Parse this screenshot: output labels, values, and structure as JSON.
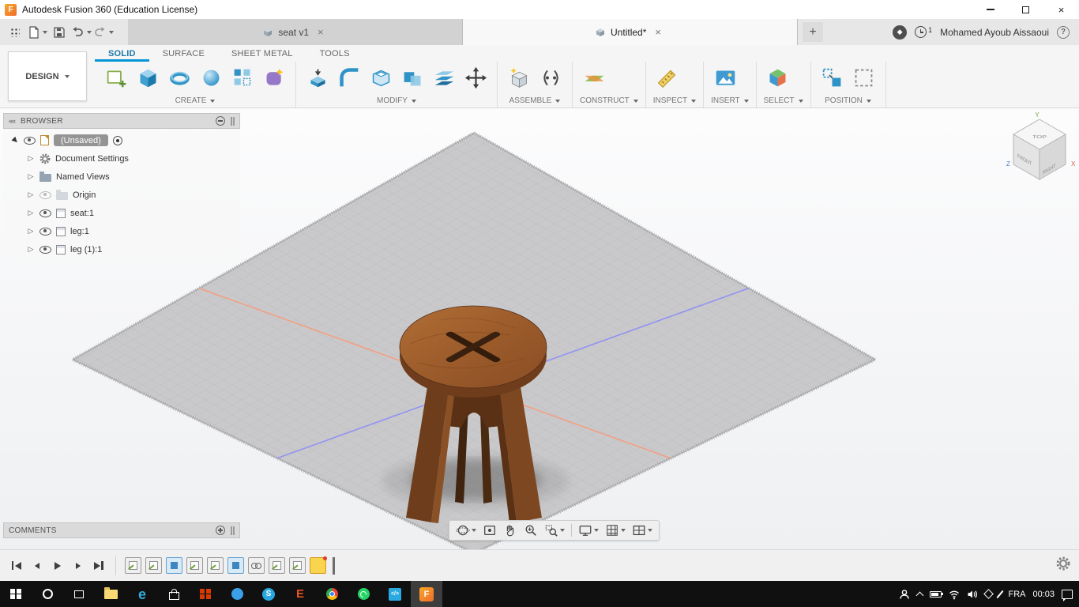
{
  "glyphs": {
    "close": "×",
    "add": "+",
    "help": "?",
    "diamond": "◆",
    "expander": "▷",
    "expander_open": "▶",
    "fusion_letter": "F",
    "collapse": "««"
  },
  "window": {
    "title": "Autodesk Fusion 360 (Education License)"
  },
  "tabs": {
    "documents": [
      {
        "label": "seat v1"
      },
      {
        "label": "Untitled*"
      }
    ]
  },
  "account": {
    "user_name": "Mohamed Ayoub Aissaoui",
    "notification_count": "1"
  },
  "ribbon": {
    "workspace_label": "DESIGN",
    "tabs": [
      "SOLID",
      "SURFACE",
      "SHEET METAL",
      "TOOLS"
    ],
    "active_tab": "SOLID",
    "groups": [
      {
        "label": "CREATE"
      },
      {
        "label": "MODIFY"
      },
      {
        "label": "ASSEMBLE"
      },
      {
        "label": "CONSTRUCT"
      },
      {
        "label": "INSPECT"
      },
      {
        "label": "INSERT"
      },
      {
        "label": "SELECT"
      },
      {
        "label": "POSITION"
      }
    ]
  },
  "browser": {
    "header": "BROWSER",
    "items": [
      {
        "label": "(Unsaved)"
      },
      {
        "label": "Document Settings"
      },
      {
        "label": "Named Views"
      },
      {
        "label": "Origin"
      },
      {
        "label": "seat:1"
      },
      {
        "label": "leg:1"
      },
      {
        "label": "leg (1):1"
      }
    ]
  },
  "comments": {
    "header": "COMMENTS"
  },
  "viewcube": {
    "top": "TOP",
    "front": "FRONT",
    "right": "RIGHT",
    "axis_x": "X",
    "axis_y": "Y",
    "axis_z": "Z"
  },
  "taskbar_icons": {
    "edge": "e",
    "skype": "S",
    "letter_e": "E",
    "code": "</>",
    "fusion": "F"
  },
  "statusbar": {
    "language": "FRA",
    "time": "00:03"
  },
  "colors": {
    "accent_blue": "#0696d7",
    "fusion_orange": "#ef6c2d",
    "plane_gray": "#c9c9cb",
    "axis_blue": "#9393f2",
    "axis_red": "#f2a083",
    "seat_wood": "#9a5a2a",
    "taskbar_black": "#101010"
  }
}
